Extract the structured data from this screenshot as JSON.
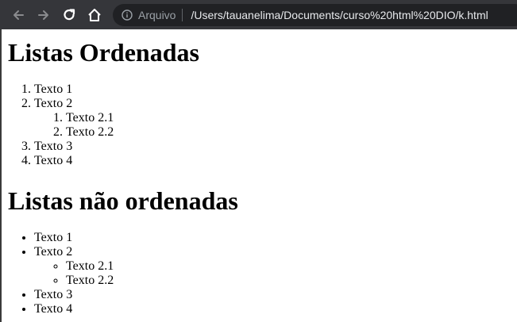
{
  "browser": {
    "scheme_label": "Arquivo",
    "url": "/Users/tauanelima/Documents/curso%20html%20DIO/k.html"
  },
  "page": {
    "ordered_heading": "Listas Ordenadas",
    "ordered_items": [
      "Texto 1",
      "Texto 2",
      "Texto 3",
      "Texto 4"
    ],
    "ordered_sub_items": [
      "Texto 2.1",
      "Texto 2.2"
    ],
    "unordered_heading": "Listas não ordenadas",
    "unordered_items": [
      "Texto 1",
      "Texto 2",
      "Texto 3",
      "Texto 4"
    ],
    "unordered_sub_items": [
      "Texto 2.1",
      "Texto 2.2"
    ]
  },
  "colors": {
    "toolbar_bg": "#35363a",
    "omnibox_bg": "#202124",
    "url_text": "#e8eaed",
    "muted_text": "#9aa0a6"
  }
}
